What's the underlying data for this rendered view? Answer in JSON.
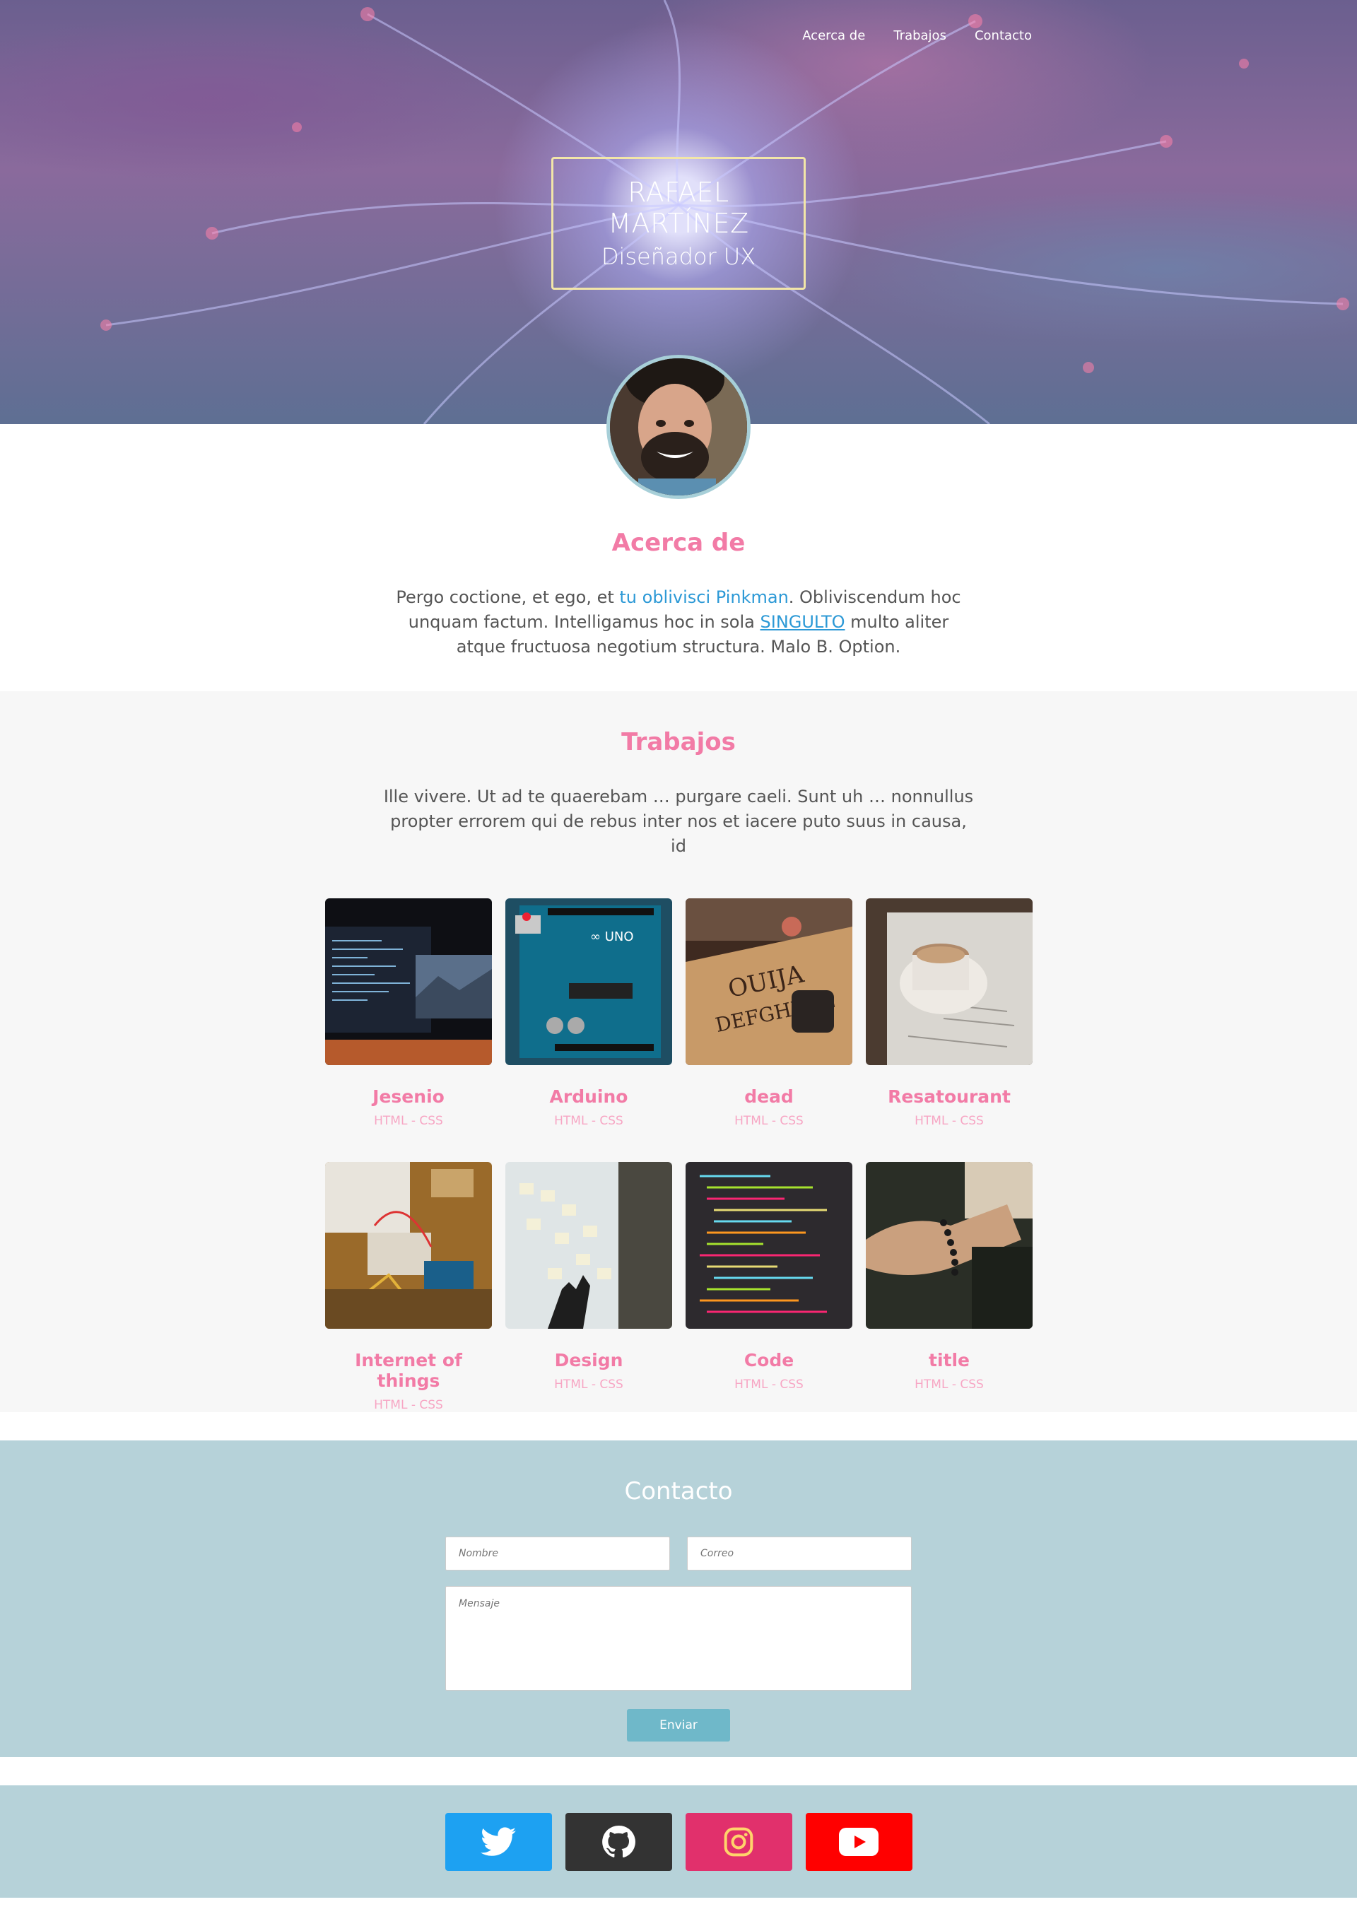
{
  "nav": {
    "items": [
      "Acerca de",
      "Trabajos",
      "Contacto"
    ]
  },
  "hero": {
    "name": "RAFAEL MARTÍNEZ",
    "role": "Diseñador UX"
  },
  "about": {
    "title": "Acerca de",
    "text_1": "Pergo coctione, et ego, et ",
    "link_1": "tu oblivisci Pinkman",
    "text_2": ". Obliviscendum hoc unquam factum. Intelligamus hoc in sola ",
    "link_2": "SINGULTO",
    "text_3": " multo aliter atque fructuosa negotium structura. Malo B. Option."
  },
  "works": {
    "title": "Trabajos",
    "description": "Ille vivere. Ut ad te quaerebam … purgare caeli. Sunt uh … nonnullus propter errorem qui de rebus inter nos et iacere puto suus in causa, id",
    "items": [
      {
        "title": "Jesenio",
        "tags": "HTML - CSS",
        "image": "monitors-code-mountains"
      },
      {
        "title": "Arduino",
        "tags": "HTML - CSS",
        "image": "arduino-uno-board"
      },
      {
        "title": "dead",
        "tags": "HTML - CSS",
        "image": "ouija-board"
      },
      {
        "title": "Resatourant",
        "tags": "HTML - CSS",
        "image": "coffee-cup"
      },
      {
        "title": "Internet of things",
        "tags": "HTML - CSS",
        "image": "breadboard-electronics"
      },
      {
        "title": "Design",
        "tags": "HTML - CSS",
        "image": "sticky-notes-wall"
      },
      {
        "title": "Code",
        "tags": "HTML - CSS",
        "image": "code-on-screen"
      },
      {
        "title": "title",
        "tags": "HTML - CSS",
        "image": "hand-meditation-beads"
      }
    ]
  },
  "contact": {
    "title": "Contacto",
    "name_placeholder": "Nombre",
    "email_placeholder": "Correo",
    "message_placeholder": "Mensaje",
    "submit_label": "Enviar"
  },
  "social": [
    {
      "icon": "twitter-icon",
      "color": "#1da1f2"
    },
    {
      "icon": "github-icon",
      "color": "#333333"
    },
    {
      "icon": "instagram-icon",
      "color": "#e1306c"
    },
    {
      "icon": "youtube-icon",
      "color": "#ff0000"
    }
  ],
  "colors": {
    "accent": "#f27ba6",
    "link": "#2c99d6",
    "contact_bg": "#b6d2d9",
    "button": "#6fb8c9"
  }
}
